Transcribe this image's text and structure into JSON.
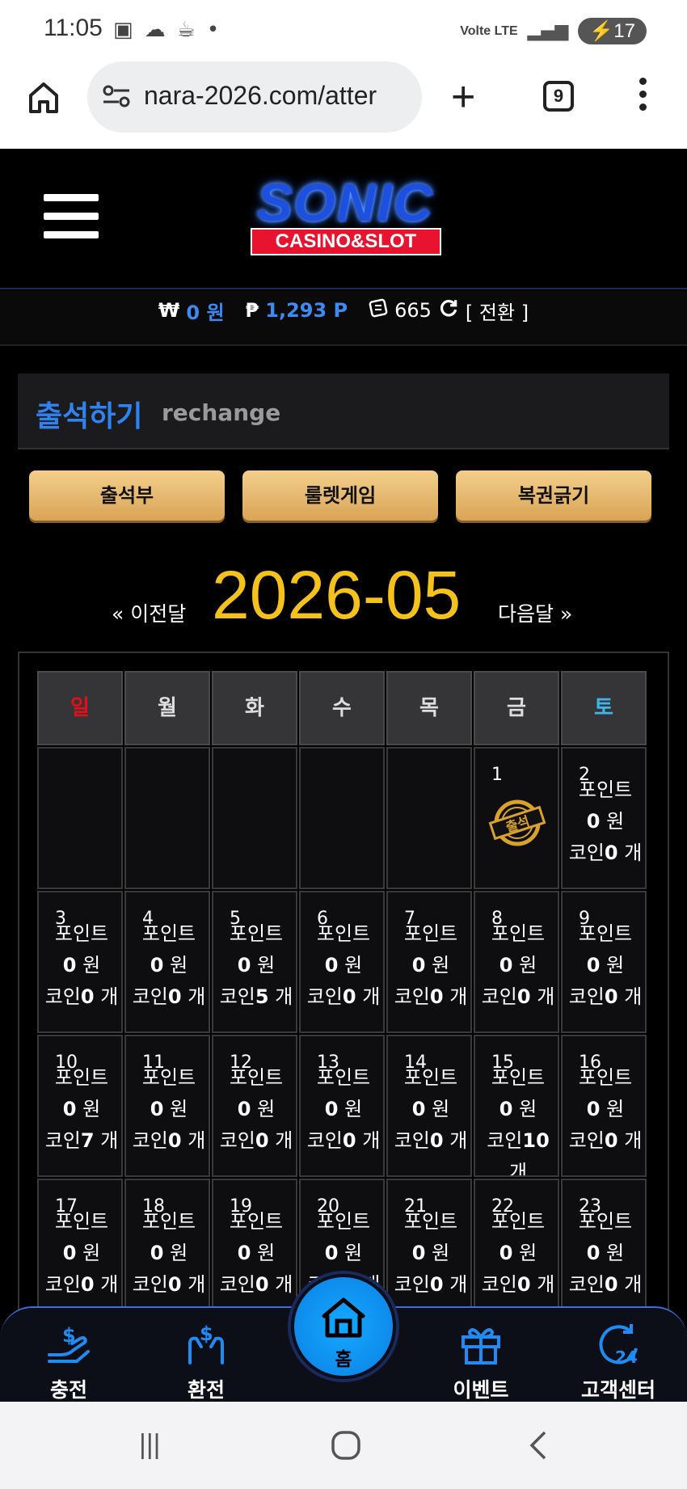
{
  "status_bar": {
    "time": "11:05",
    "network": "Volte LTE",
    "battery": "17"
  },
  "browser": {
    "url": "nara-2026.com/atter",
    "tab_count": "9"
  },
  "header": {
    "logo_main": "SONIC",
    "logo_sub": "CASINO&SLOT"
  },
  "balance": {
    "won_symbol": "₩",
    "won_value": "0 원",
    "point_symbol": "₱",
    "point_value": "1,293 P",
    "coin_value": "665",
    "exchange_label": "[ 전환 ]"
  },
  "section": {
    "title_ko": "출석하기",
    "title_en": "rechange"
  },
  "tabs": [
    {
      "label": "출석부"
    },
    {
      "label": "룰렛게임"
    },
    {
      "label": "복권긁기"
    }
  ],
  "month_nav": {
    "prev": "« 이전달",
    "month": "2026-05",
    "next": "다음달 »"
  },
  "calendar": {
    "weekdays": [
      "일",
      "월",
      "화",
      "수",
      "목",
      "금",
      "토"
    ],
    "stamp_text": "출석",
    "point_label": "포인트",
    "coin_label": "코인",
    "won_unit": "원",
    "count_unit": "개",
    "days": [
      {
        "day": "1",
        "stamp": true
      },
      {
        "day": "2",
        "points": "0",
        "coins": "0"
      },
      {
        "day": "3",
        "points": "0",
        "coins": "0"
      },
      {
        "day": "4",
        "points": "0",
        "coins": "0"
      },
      {
        "day": "5",
        "points": "0",
        "coins": "5"
      },
      {
        "day": "6",
        "points": "0",
        "coins": "0"
      },
      {
        "day": "7",
        "points": "0",
        "coins": "0"
      },
      {
        "day": "8",
        "points": "0",
        "coins": "0"
      },
      {
        "day": "9",
        "points": "0",
        "coins": "0"
      },
      {
        "day": "10",
        "points": "0",
        "coins": "7"
      },
      {
        "day": "11",
        "points": "0",
        "coins": "0"
      },
      {
        "day": "12",
        "points": "0",
        "coins": "0"
      },
      {
        "day": "13",
        "points": "0",
        "coins": "0"
      },
      {
        "day": "14",
        "points": "0",
        "coins": "0"
      },
      {
        "day": "15",
        "points": "0",
        "coins": "10"
      },
      {
        "day": "16",
        "points": "0",
        "coins": "0"
      },
      {
        "day": "17",
        "points": "0",
        "coins": "0"
      },
      {
        "day": "18",
        "points": "0",
        "coins": "0"
      },
      {
        "day": "19",
        "points": "0",
        "coins": "0"
      },
      {
        "day": "20",
        "points": "0",
        "coins": "0"
      },
      {
        "day": "21",
        "points": "0",
        "coins": "0"
      },
      {
        "day": "22",
        "points": "0",
        "coins": "0"
      },
      {
        "day": "23",
        "points": "0",
        "coins": "0"
      }
    ]
  },
  "bottom_nav": {
    "charge": "충전",
    "exchange": "환전",
    "home": "홈",
    "event": "이벤트",
    "support": "고객센터"
  },
  "colors": {
    "accent_blue": "#2f83f0",
    "gold": "#f4c21b",
    "sunday": "#e0101a",
    "saturday": "#3fb6ea"
  }
}
